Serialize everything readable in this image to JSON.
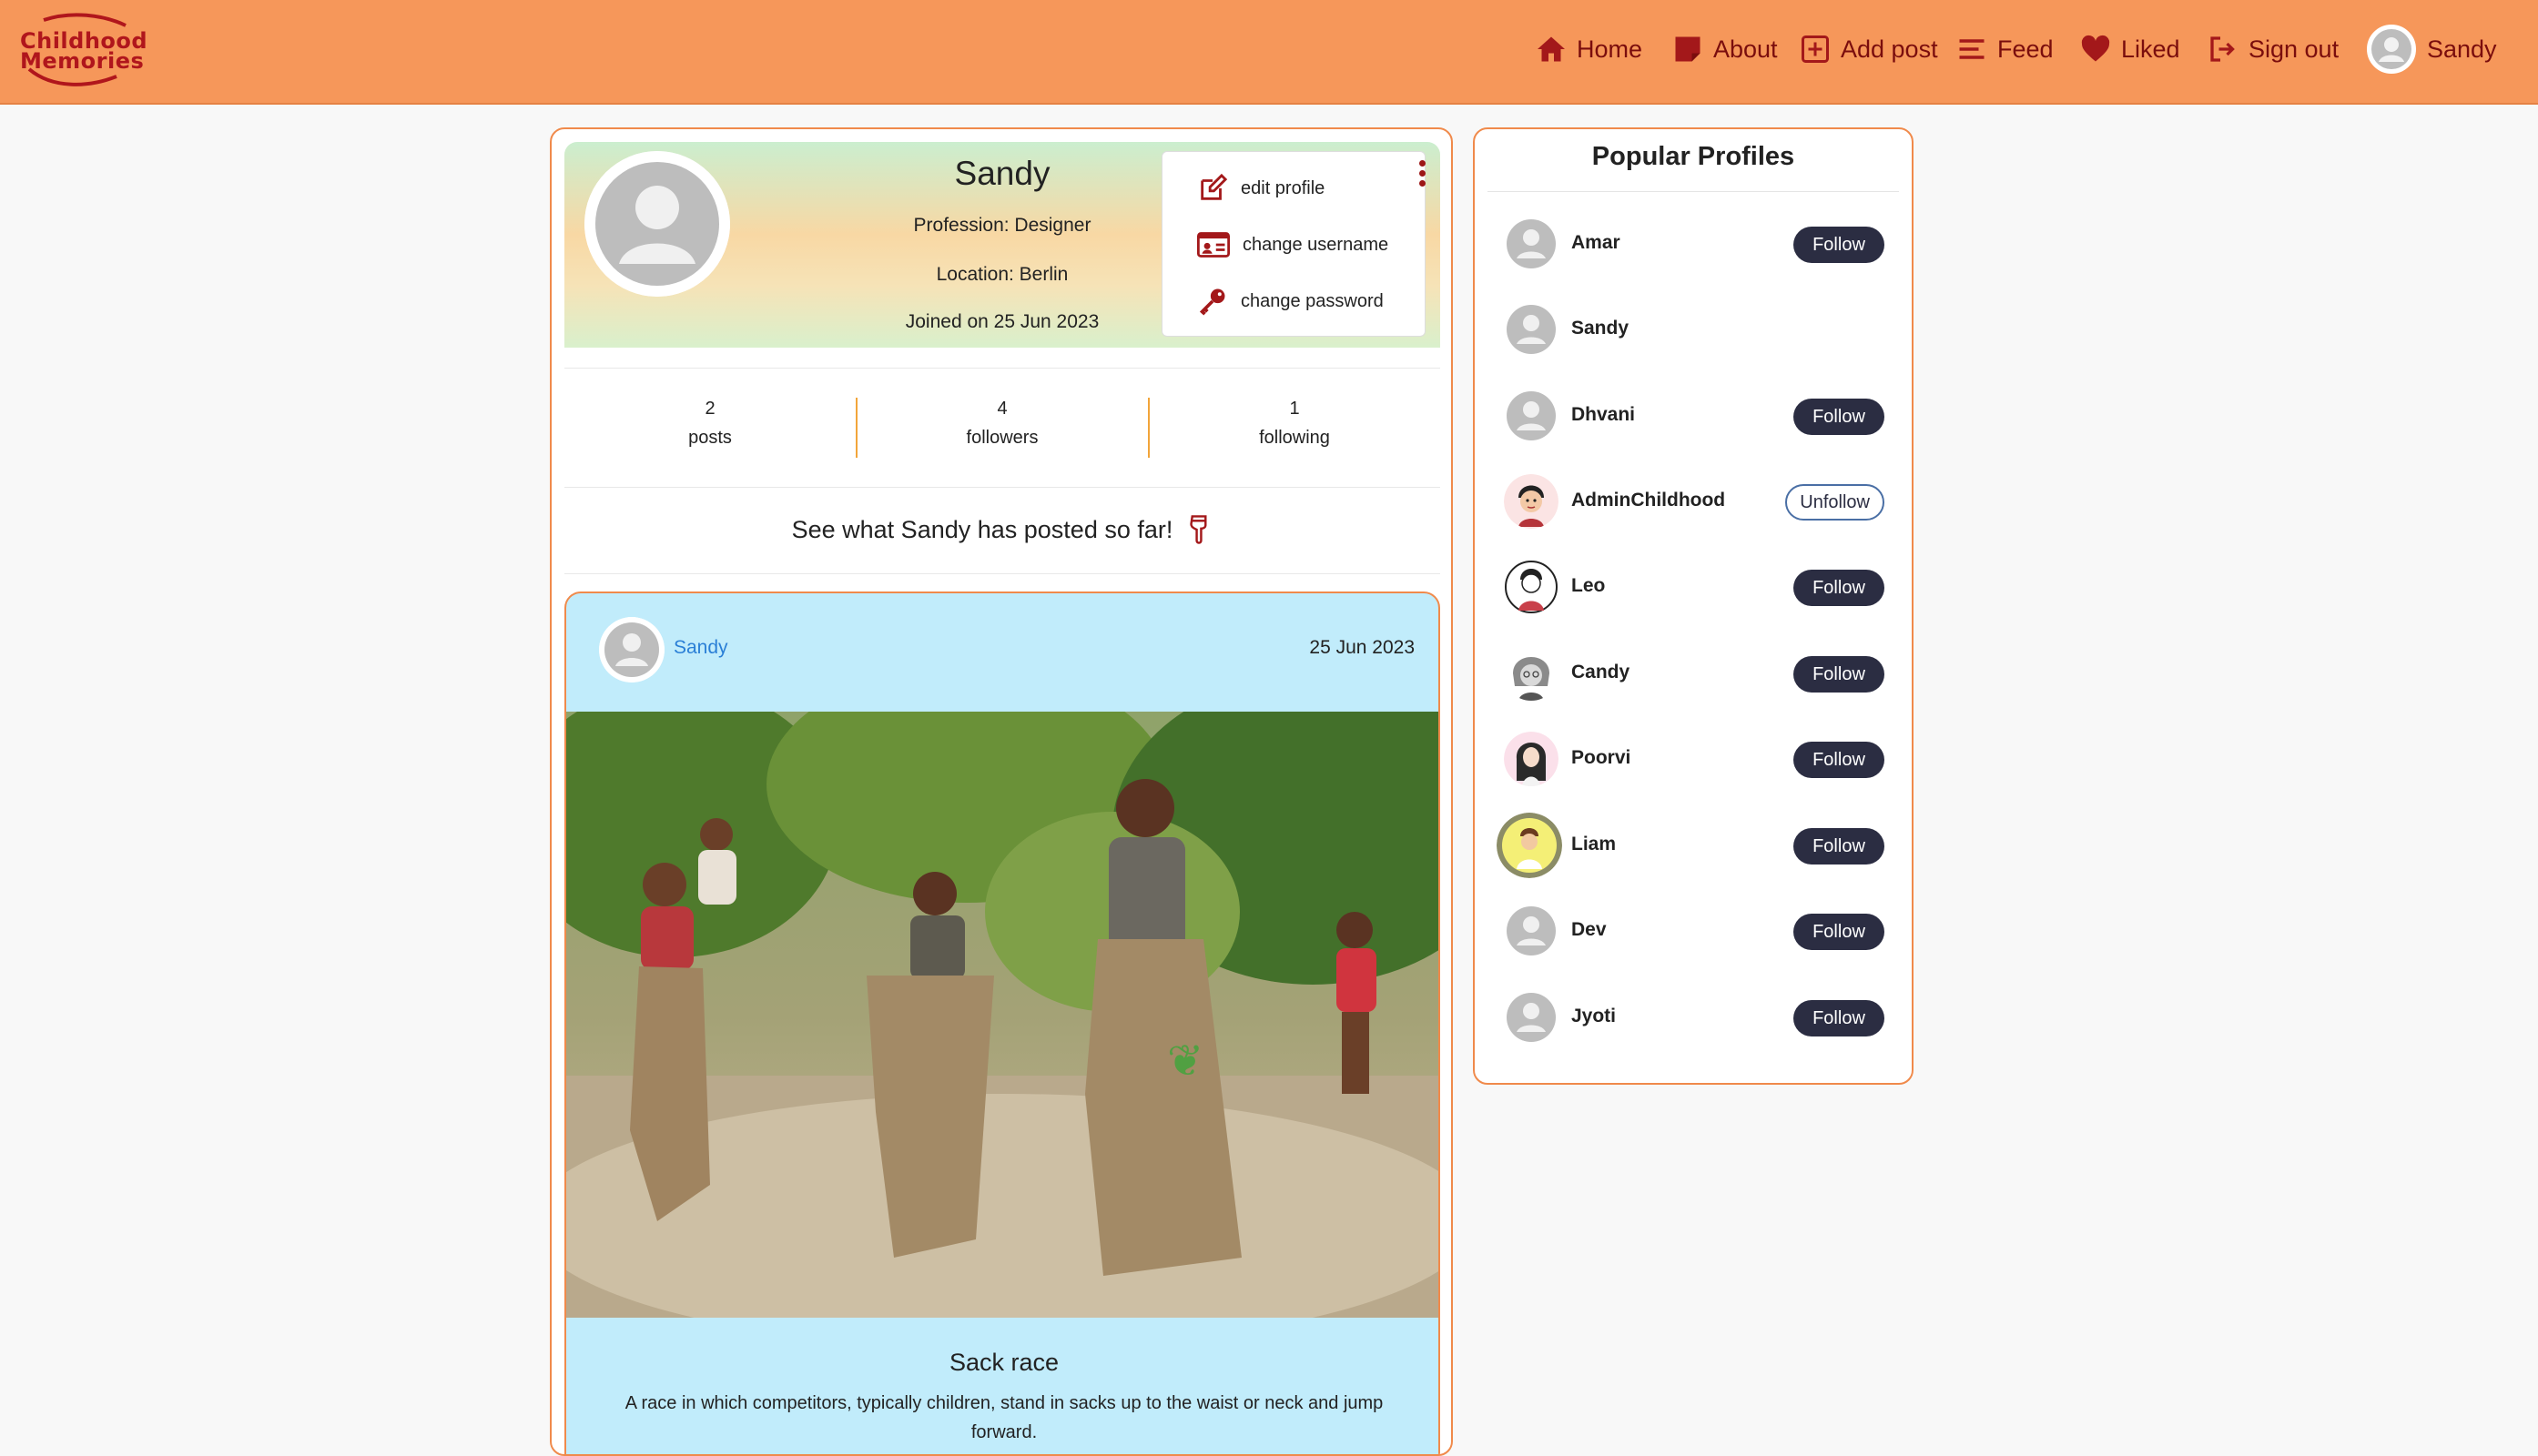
{
  "brand": {
    "logo_line1": "Childhood",
    "logo_line2": "Memories"
  },
  "nav": {
    "home": "Home",
    "about": "About",
    "add_post": "Add post",
    "feed": "Feed",
    "liked": "Liked",
    "sign_out": "Sign out",
    "user": "Sandy"
  },
  "profile": {
    "name": "Sandy",
    "profession": "Profession: Designer",
    "location": "Location: Berlin",
    "joined": "Joined on 25 Jun 2023",
    "menu": {
      "edit": "edit profile",
      "change_username": "change username",
      "change_password": "change password"
    },
    "stats": [
      {
        "count": "2",
        "label": "posts"
      },
      {
        "count": "4",
        "label": "followers"
      },
      {
        "count": "1",
        "label": "following"
      }
    ],
    "posted_heading": "See what Sandy has posted so far!"
  },
  "post": {
    "author": "Sandy",
    "date": "25 Jun 2023",
    "title": "Sack race",
    "description": "A race in which competitors, typically children, stand in sacks up to the waist or neck and jump forward."
  },
  "sidebar": {
    "title": "Popular Profiles",
    "profiles": [
      {
        "name": "Amar",
        "button": "Follow"
      },
      {
        "name": "Sandy",
        "button": ""
      },
      {
        "name": "Dhvani",
        "button": "Follow"
      },
      {
        "name": "AdminChildhood",
        "button": "Unfollow"
      },
      {
        "name": "Leo",
        "button": "Follow"
      },
      {
        "name": "Candy",
        "button": "Follow"
      },
      {
        "name": "Poorvi",
        "button": "Follow"
      },
      {
        "name": "Liam",
        "button": "Follow"
      },
      {
        "name": "Dev",
        "button": "Follow"
      },
      {
        "name": "Jyoti",
        "button": "Follow"
      }
    ]
  },
  "colors": {
    "navbar": "#f6975a",
    "nav_text": "#7a0d0d",
    "accent_border": "#f08a4b",
    "post_bg": "#c1ecfb",
    "button_dark": "#2b2d42"
  }
}
